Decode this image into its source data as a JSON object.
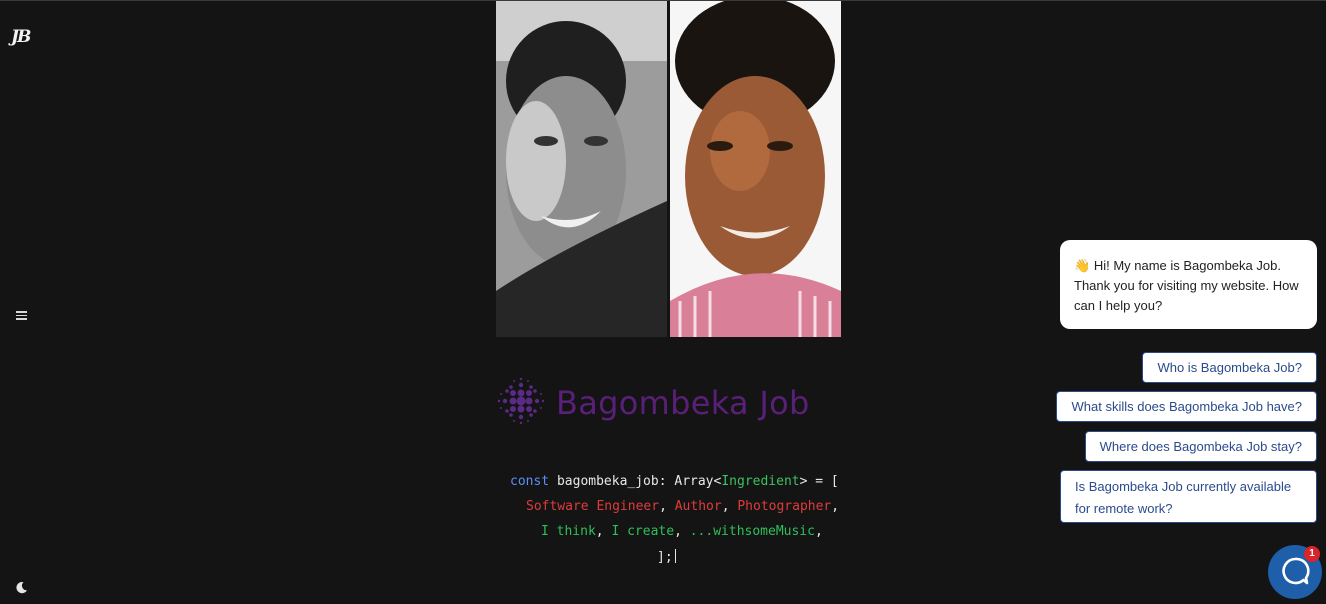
{
  "sidebar": {
    "logo_text": "JB",
    "menu_icon": "hamburger-menu-icon",
    "theme_icon": "moon-icon"
  },
  "photos": {
    "left_desc": "grayscale-portrait",
    "right_desc": "color-portrait"
  },
  "brand": {
    "name": "Bagombeka Job",
    "color": "#5a1f78",
    "icon": "dot-burst-logo-icon"
  },
  "code": {
    "line1": {
      "kw": "const",
      "ident": " bagombeka_job",
      "colon": ": ",
      "array": "Array<",
      "type": "Ingredient",
      "close": "> = ["
    },
    "line2": {
      "a": "Software Engineer",
      "s1": ", ",
      "b": "Author",
      "s2": ", ",
      "c": "Photographer",
      "s3": ","
    },
    "line3": {
      "a": "I think",
      "s1": ", ",
      "b": "I create",
      "s2": ", ",
      "c": "...withsomeMusic",
      "s3": ","
    },
    "line4": "];"
  },
  "chat": {
    "greeting_emoji": "👋",
    "greeting": "Hi! My name is Bagombeka Job. Thank you for visiting my website. How can I help you?",
    "options": [
      "Who is Bagombeka Job?",
      "What skills does Bagombeka Job have?",
      "Where does Bagombeka Job stay?",
      "Is Bagombeka Job currently available for remote work?"
    ],
    "launcher_icon": "chat-bubble-icon",
    "badge_count": "1",
    "accent": "#1f5ea8"
  }
}
